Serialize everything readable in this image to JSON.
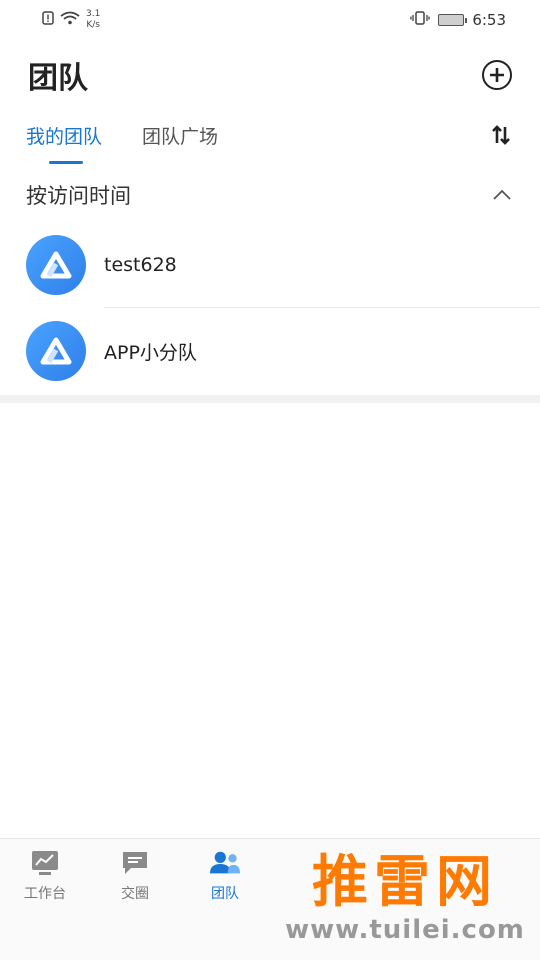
{
  "status_bar": {
    "net_speed_value": "3.1",
    "net_speed_unit": "K/s",
    "time": "6:53"
  },
  "header": {
    "title": "团队"
  },
  "tabs": [
    {
      "label": "我的团队",
      "active": true
    },
    {
      "label": "团队广场",
      "active": false
    }
  ],
  "section": {
    "title": "按访问时间"
  },
  "teams": [
    {
      "name": "test628"
    },
    {
      "name": "APP小分队"
    }
  ],
  "bottom_nav": [
    {
      "label": "工作台",
      "icon": "chart-monitor-icon",
      "active": false
    },
    {
      "label": "交圈",
      "icon": "chat-bubble-icon",
      "active": false
    },
    {
      "label": "团队",
      "icon": "people-icon",
      "active": true
    }
  ],
  "watermark": {
    "main": "推雷网",
    "sub": "www.tuilei.com"
  },
  "colors": {
    "accent": "#1976d2",
    "avatar": "#3d8ff5",
    "watermark_orange": "#ff7a00"
  }
}
